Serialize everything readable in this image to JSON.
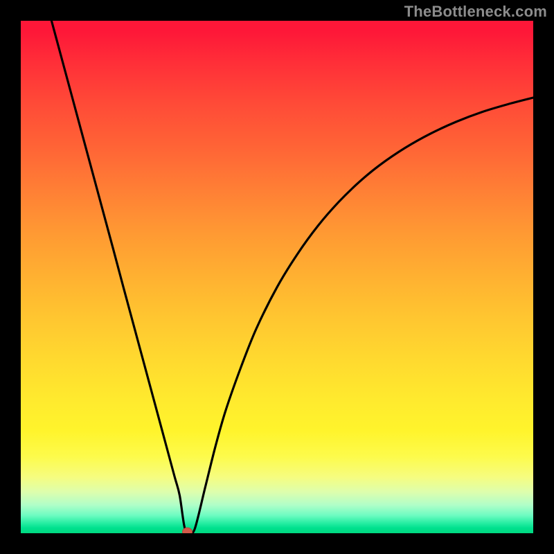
{
  "watermark": "TheBottleneck.com",
  "chart_data": {
    "type": "line",
    "title": "",
    "xlabel": "",
    "ylabel": "",
    "xlim": [
      0,
      100
    ],
    "ylim": [
      0,
      100
    ],
    "grid": false,
    "annotations": [
      {
        "kind": "marker",
        "shape": "circle",
        "x": 32.5,
        "y": 0,
        "color": "#d35a4a"
      }
    ],
    "series": [
      {
        "name": "bottleneck-curve",
        "color": "#000000",
        "x": [
          6,
          8,
          10,
          12,
          14,
          16,
          18,
          20,
          22,
          24,
          26,
          28,
          30,
          31,
          32,
          33,
          34,
          36,
          38,
          40,
          43,
          46,
          50,
          54,
          58,
          62,
          66,
          70,
          75,
          80,
          85,
          90,
          95,
          100
        ],
        "y": [
          100,
          92.6,
          85.2,
          77.8,
          70.4,
          63.0,
          55.6,
          48.1,
          40.7,
          33.3,
          25.9,
          18.5,
          11.1,
          7.4,
          1.0,
          0.2,
          1.0,
          9.0,
          17.0,
          24.0,
          32.5,
          40.0,
          48.0,
          54.5,
          60.0,
          64.6,
          68.5,
          71.8,
          75.2,
          78.0,
          80.3,
          82.2,
          83.7,
          85.0
        ]
      }
    ],
    "background_gradient": {
      "direction": "vertical",
      "stops": [
        {
          "pos": 0.0,
          "color": "#fe1738"
        },
        {
          "pos": 0.33,
          "color": "#ff7f35"
        },
        {
          "pos": 0.66,
          "color": "#ffd92f"
        },
        {
          "pos": 0.85,
          "color": "#fdfb4b"
        },
        {
          "pos": 0.95,
          "color": "#b0fec8"
        },
        {
          "pos": 1.0,
          "color": "#00d980"
        }
      ]
    }
  }
}
